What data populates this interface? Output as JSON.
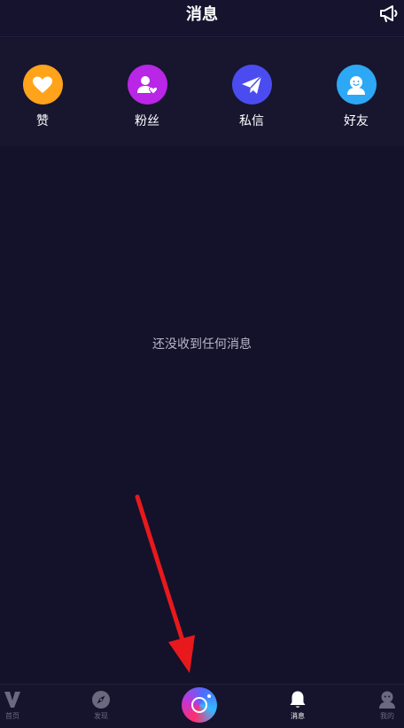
{
  "header": {
    "title": "消息",
    "announce_icon": "megaphone-icon"
  },
  "categories": [
    {
      "label": "赞",
      "icon": "heart-icon",
      "color": "#ffa31a"
    },
    {
      "label": "粉丝",
      "icon": "follower-icon",
      "color": "#b926e6"
    },
    {
      "label": "私信",
      "icon": "paper-plane-icon",
      "color": "#4b4cf0"
    },
    {
      "label": "好友",
      "icon": "friend-icon",
      "color": "#2ca8f5"
    }
  ],
  "empty_state": {
    "text": "还没收到任何消息"
  },
  "annotation": {
    "arrow_color": "#e8191c"
  },
  "tabbar": {
    "tabs": [
      {
        "label": "首页",
        "icon": "v-logo-icon",
        "active": false
      },
      {
        "label": "发现",
        "icon": "compass-icon",
        "active": false
      },
      {
        "label": "消息",
        "icon": "bell-icon",
        "active": true
      },
      {
        "label": "我的",
        "icon": "profile-icon",
        "active": false
      }
    ],
    "record_icon": "camera-record-icon"
  }
}
